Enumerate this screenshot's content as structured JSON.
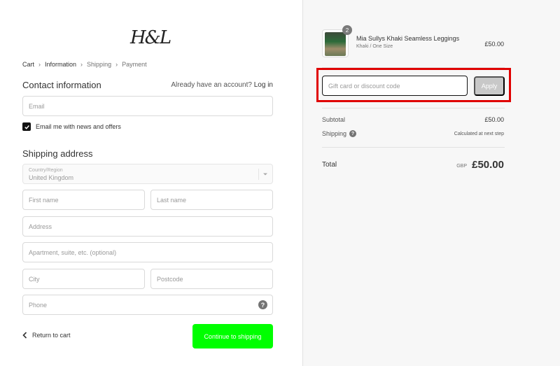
{
  "logo": {
    "text": "H&L"
  },
  "breadcrumb": [
    "Cart",
    "Information",
    "Shipping",
    "Payment"
  ],
  "contact": {
    "title": "Contact information",
    "login_prompt": "Already have an account?",
    "login_link": "Log in",
    "email_placeholder": "Email",
    "newsletter_label": "Email me with news and offers",
    "newsletter_checked": true
  },
  "shipping": {
    "title": "Shipping address",
    "country_label": "Country/Region",
    "country_value": "United Kingdom",
    "first_name_placeholder": "First name",
    "last_name_placeholder": "Last name",
    "address_placeholder": "Address",
    "apartment_placeholder": "Apartment, suite, etc. (optional)",
    "city_placeholder": "City",
    "postcode_placeholder": "Postcode",
    "phone_placeholder": "Phone"
  },
  "actions": {
    "return_label": "Return to cart",
    "continue_label": "Continue to shipping",
    "continue_color": "#00ff00"
  },
  "summary": {
    "product": {
      "name": "Mia Sullys Khaki Seamless Leggings",
      "variant": "Khaki / One Size",
      "price": "£50.00",
      "quantity": "2"
    },
    "discount_placeholder": "Gift card or discount code",
    "apply_label": "Apply",
    "subtotal_label": "Subtotal",
    "subtotal_value": "£50.00",
    "shipping_label": "Shipping",
    "shipping_value": "Calculated at next step",
    "total_label": "Total",
    "total_currency": "GBP",
    "total_value": "£50.00",
    "highlight_color": "#e00000"
  }
}
